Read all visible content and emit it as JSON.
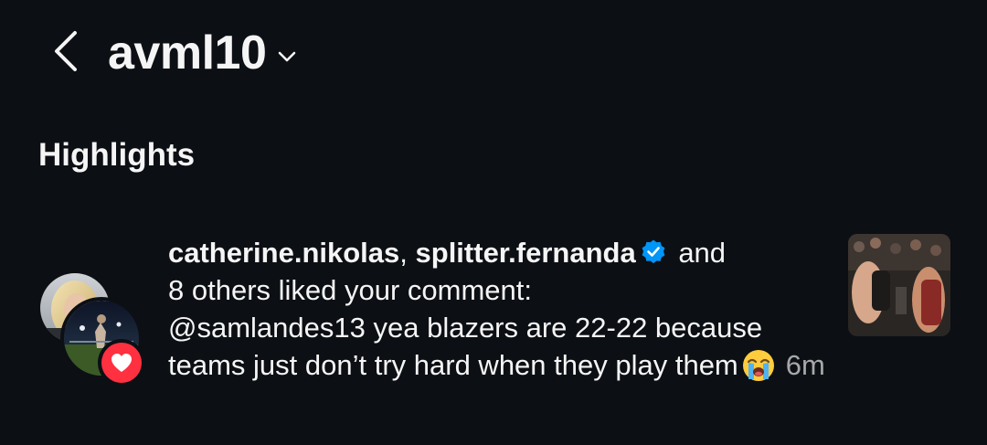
{
  "header": {
    "account_name": "avml10",
    "back_icon": "chevron-left-icon",
    "switch_icon": "chevron-down-icon"
  },
  "section": {
    "title": "Highlights"
  },
  "notification": {
    "user1": "catherine.nikolas",
    "separator": ", ",
    "user2": "splitter.fernanda",
    "user2_verified": true,
    "and_text": " and",
    "others_text": "8 others liked your comment:",
    "comment_text": "@samlandes13 yea blazers are 22-22 because teams just don’t try hard when they play them",
    "emoji": "loudly-crying-face-icon",
    "timestamp": "6m",
    "badge_icon": "heart-icon"
  },
  "colors": {
    "background": "#0c0f14",
    "text_primary": "#f5f5f5",
    "text_secondary": "#a8a8a8",
    "verified_blue": "#0095f6",
    "like_red": "#ff3040"
  }
}
